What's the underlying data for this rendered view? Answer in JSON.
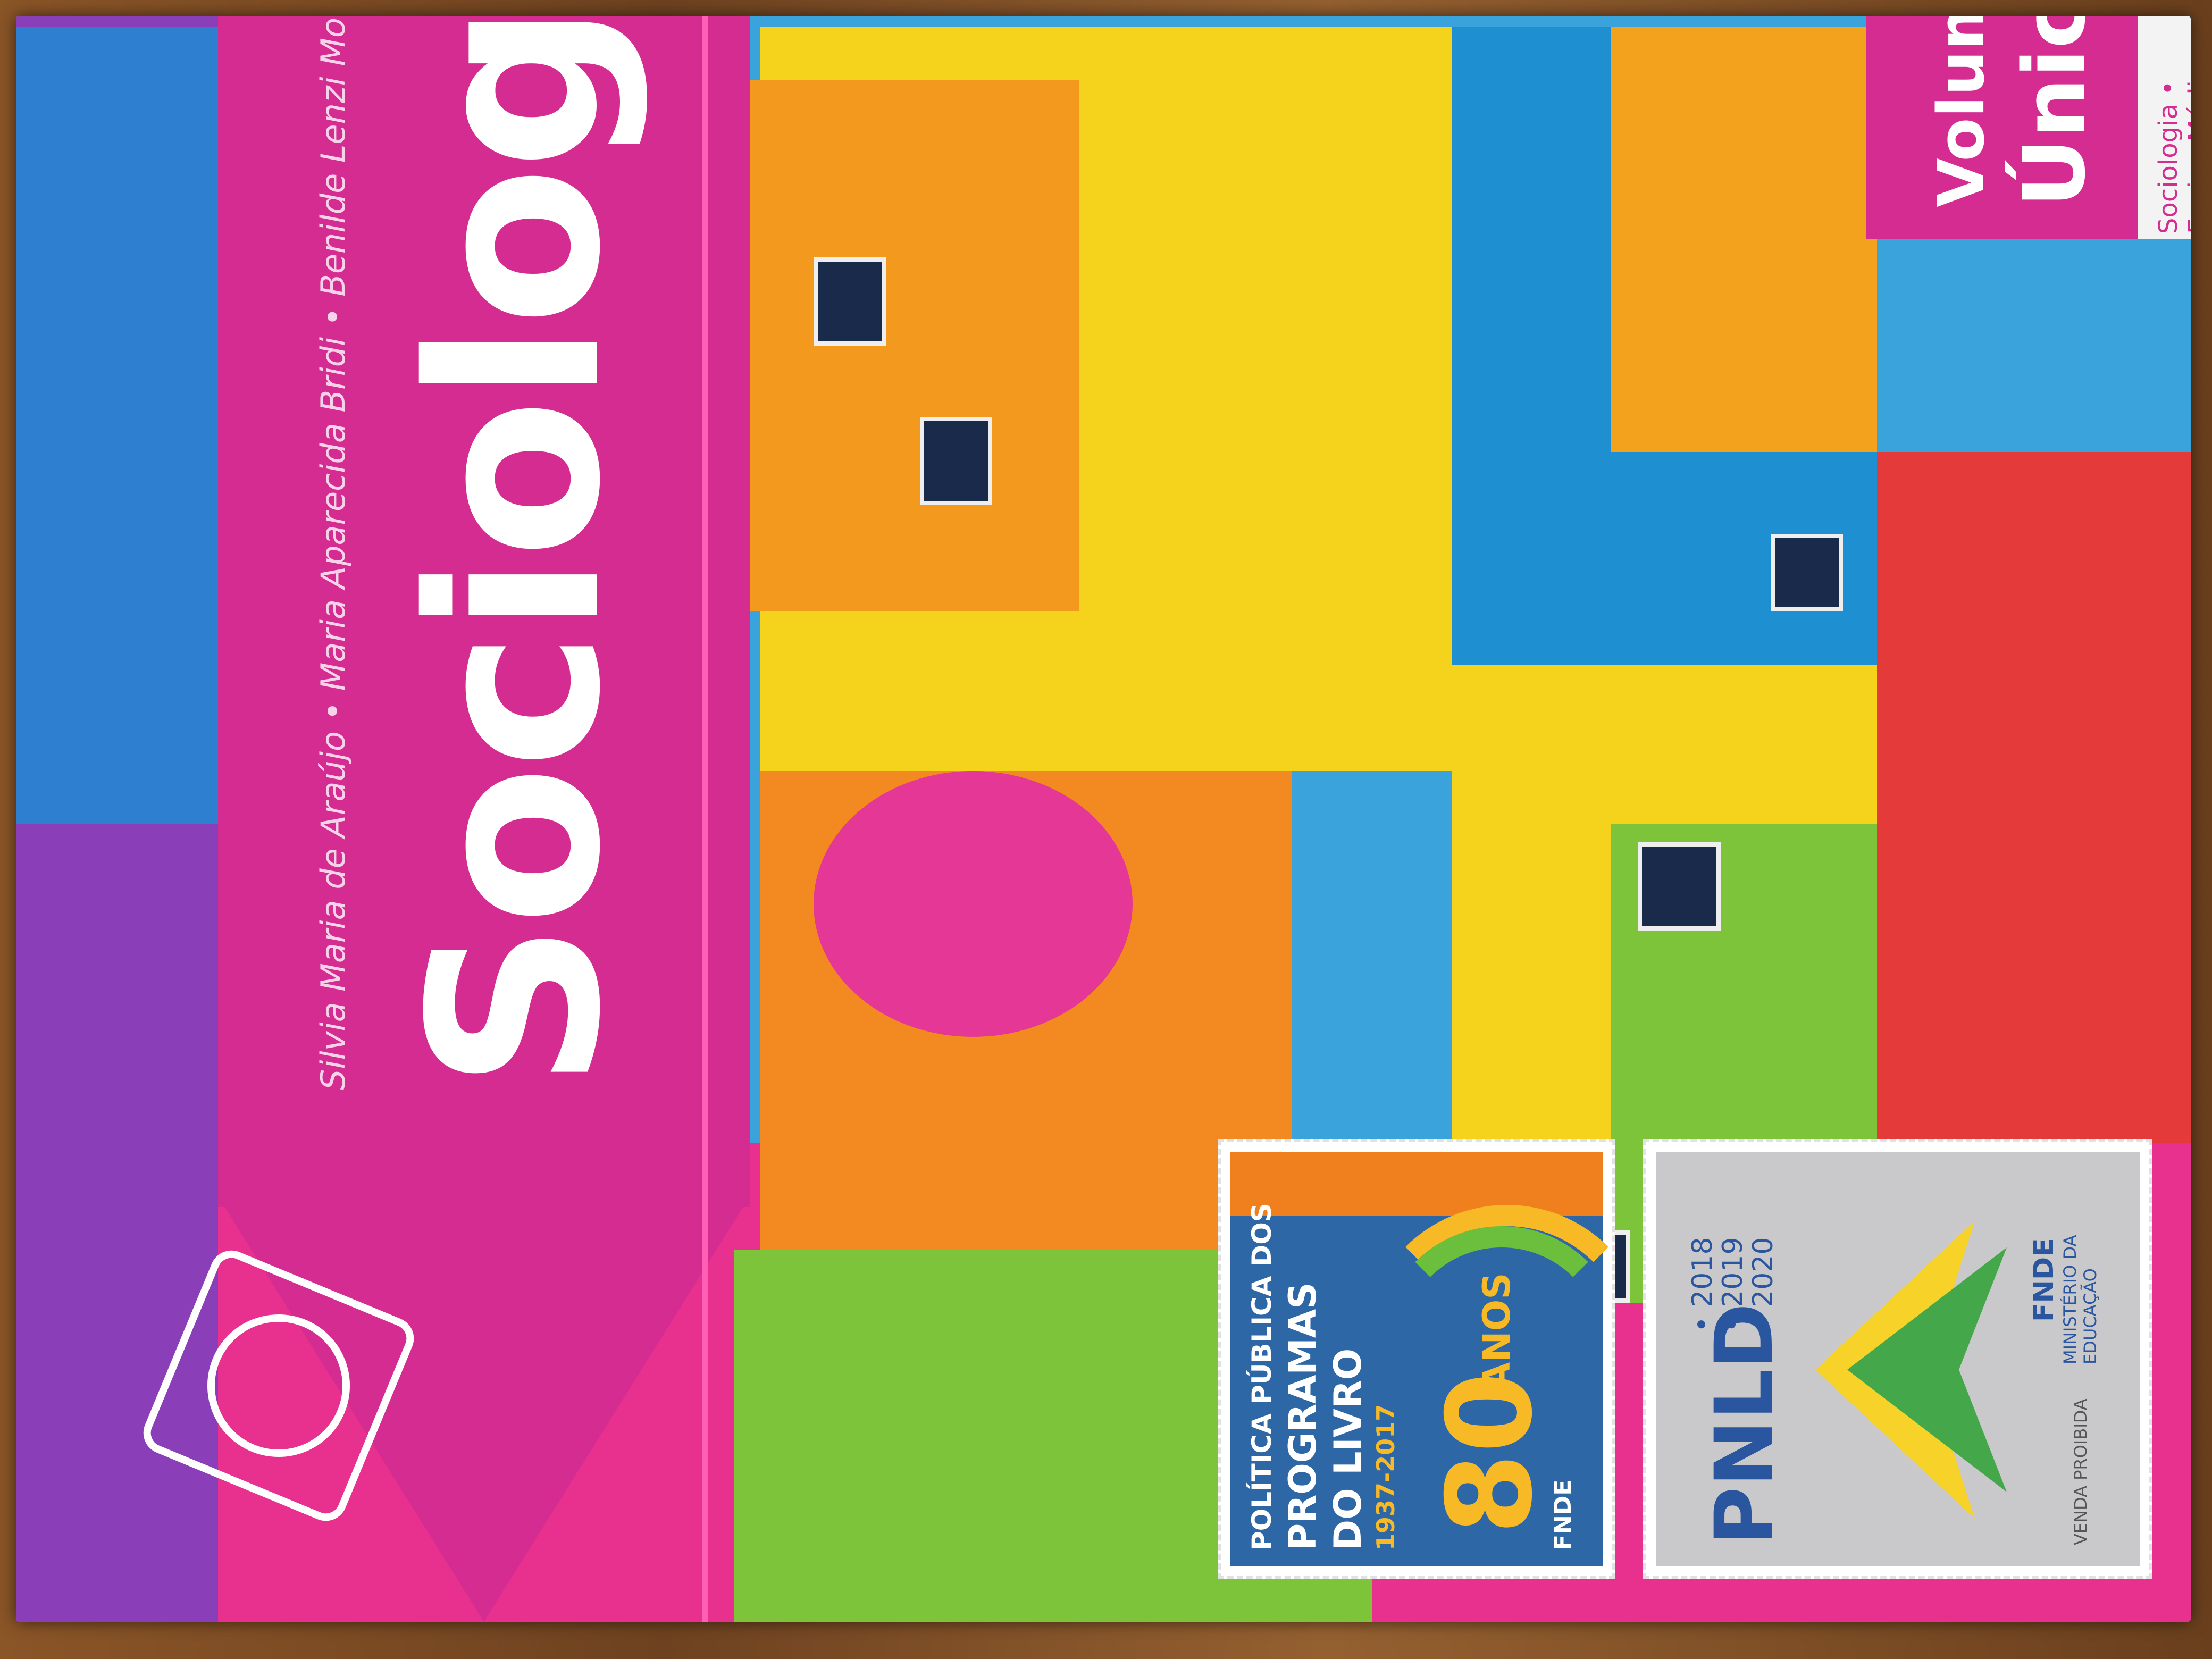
{
  "cover": {
    "title": "Sociologia",
    "authors": "Silvia Maria de Araújo • Maria Aparecida Bridi • Benilde Lenzi Motim",
    "volume_line1": "Volume",
    "volume_line2": "Único",
    "volume_subtitle": "Sociologia • Ensino Médio",
    "brand_color": "#d42c90"
  },
  "stamp_pnld_80": {
    "line1": "POLÍTICA PÚBLICA DOS",
    "line2": "PROGRAMAS",
    "line3": "DO LIVRO",
    "years": "1937-2017",
    "big_number": "80",
    "anos": "ANOS",
    "fnde": "FNDE"
  },
  "stamp_pnld": {
    "name": "PNLD",
    "years": [
      "• 2018",
      "• 2019",
      "• 2020"
    ],
    "fnde": "FNDE",
    "ministerio": "MINISTÉRIO DA EDUCAÇÃO",
    "venda": "VENDA PROIBIDA"
  },
  "icons": {
    "publisher_logo": "rosette-icon"
  }
}
